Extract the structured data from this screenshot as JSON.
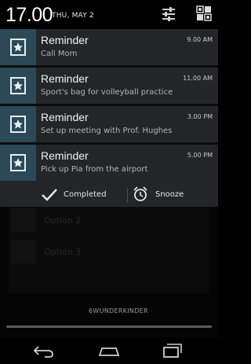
{
  "status": {
    "time": "17.00",
    "date": "THU, MAY 2"
  },
  "notifications": [
    {
      "title": "Reminder",
      "text": "Call Mom",
      "time": "9.00 AM"
    },
    {
      "title": "Reminder",
      "text": "Sport's bag for volleyball practice",
      "time": "11.00 AM"
    },
    {
      "title": "Reminder",
      "text": "Set up meeting with Prof. Hughes",
      "time": "3.00 PM"
    },
    {
      "title": "Reminder",
      "text": "Pick up Pia from the airport",
      "time": "5.00 PM"
    }
  ],
  "actions": {
    "completed_label": "Completed",
    "snooze_label": "Snooze"
  },
  "background_app": {
    "options": [
      "Option 2",
      "Option 3"
    ],
    "brand": "6WUNDERKINDER"
  },
  "colors": {
    "notification_bg": "#232628",
    "icon_bg": "#2b4957"
  },
  "icons": {
    "settings": "settings-sliders-icon",
    "quick_settings": "quick-settings-icon",
    "reminder": "reminder-star-icon",
    "completed": "checkmark-icon",
    "snooze": "alarm-clock-icon",
    "back": "back-icon",
    "home": "home-icon",
    "recents": "recents-icon"
  }
}
